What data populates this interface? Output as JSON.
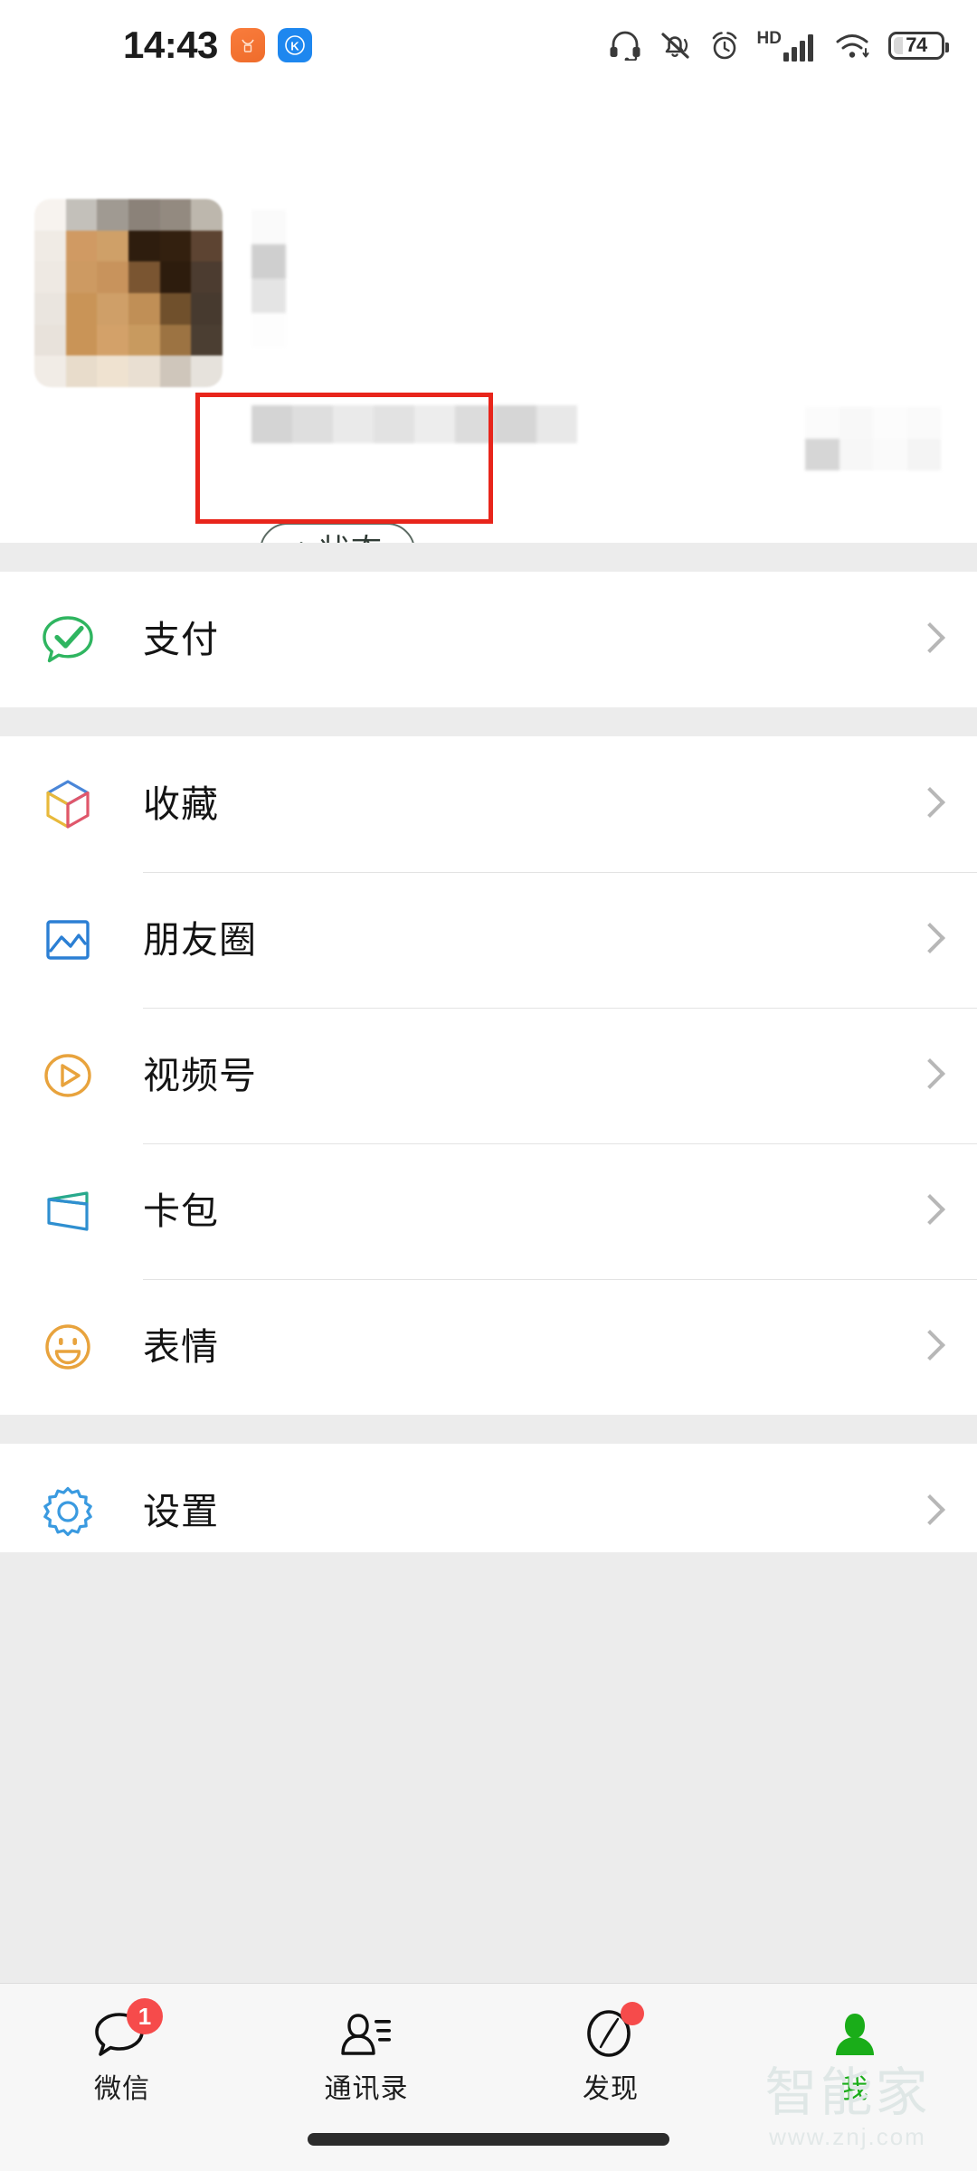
{
  "status_bar": {
    "time": "14:43",
    "app_icons": [
      {
        "name": "taobao-icon",
        "glyph": "淘"
      },
      {
        "name": "kuaishou-icon",
        "glyph": "K"
      }
    ],
    "hd_label": "HD",
    "battery_percent": "74",
    "icons": [
      "headset-icon",
      "bell-muted-icon",
      "alarm-clock-icon",
      "hd-signal-icon",
      "wifi-icon",
      "battery-icon"
    ]
  },
  "profile": {
    "avatar_redacted": true,
    "nickname_redacted": true,
    "wechat_id_redacted": true,
    "qr_redacted": true,
    "status_button": {
      "plus": "+",
      "label": "状态"
    }
  },
  "annotation": {
    "color": "#e8251b",
    "target": "status-button"
  },
  "menu": {
    "groups": [
      {
        "items": [
          {
            "label": "支付",
            "icon": "pay-icon",
            "color": "#2fb560"
          }
        ]
      },
      {
        "items": [
          {
            "label": "收藏",
            "icon": "favorites-icon",
            "color": "#4a86d8"
          },
          {
            "label": "朋友圈",
            "icon": "moments-icon",
            "color": "#2b7fd4"
          },
          {
            "label": "视频号",
            "icon": "channels-icon",
            "color": "#e8a33d"
          },
          {
            "label": "卡包",
            "icon": "cards-icon",
            "color": "#2f9fd8"
          },
          {
            "label": "表情",
            "icon": "stickers-icon",
            "color": "#e8a33d"
          }
        ]
      },
      {
        "items": [
          {
            "label": "设置",
            "icon": "settings-icon",
            "color": "#3a9ae0"
          }
        ]
      }
    ]
  },
  "tabbar": {
    "tabs": [
      {
        "label": "微信",
        "icon": "chat-icon",
        "badge": "1",
        "active": false
      },
      {
        "label": "通讯录",
        "icon": "contacts-icon",
        "badge": "",
        "active": false
      },
      {
        "label": "发现",
        "icon": "discover-icon",
        "badge": "",
        "dot": true,
        "active": false
      },
      {
        "label": "我",
        "icon": "me-icon",
        "badge": "",
        "active": true
      }
    ],
    "active_color": "#1aad19"
  },
  "watermark": {
    "main": "智能家",
    "sub": "www.znj.com"
  }
}
